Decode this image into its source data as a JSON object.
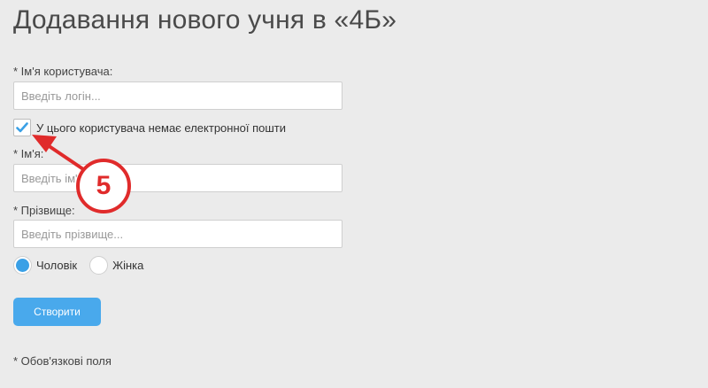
{
  "page": {
    "title": "Додавання нового учня в «4Б»"
  },
  "form": {
    "username": {
      "label": "* Ім'я користувача:",
      "placeholder": "Введіть логін...",
      "value": ""
    },
    "no_email": {
      "label": "У цього користувача немає електронної пошти",
      "checked": true
    },
    "first_name": {
      "label": "* Ім'я:",
      "placeholder": "Введіть ім'я...",
      "value": ""
    },
    "last_name": {
      "label": "* Прізвище:",
      "placeholder": "Введіть прізвище...",
      "value": ""
    },
    "gender": {
      "options": [
        {
          "label": "Чоловік",
          "selected": true
        },
        {
          "label": "Жінка",
          "selected": false
        }
      ]
    },
    "submit_label": "Створити",
    "required_note": "* Обов'язкові поля"
  },
  "annotation": {
    "step_number": "5",
    "color": "#e02b2b"
  },
  "colors": {
    "background": "#ebebeb",
    "accent": "#49a9ec"
  }
}
